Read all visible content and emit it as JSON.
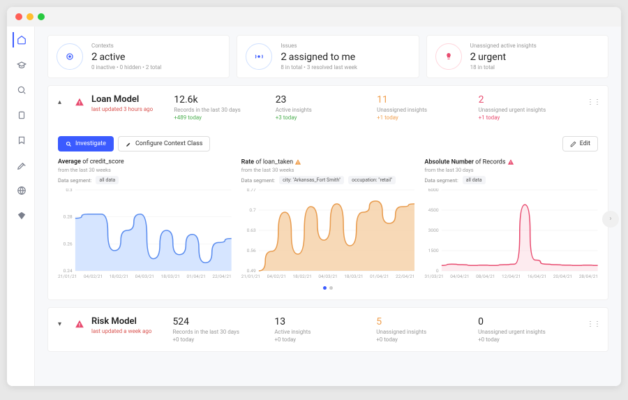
{
  "summary": {
    "contexts": {
      "label": "Contexts",
      "value": "2",
      "suffix": "active",
      "sub": "0 inactive • 0 hidden • 2 total"
    },
    "issues": {
      "label": "Issues",
      "value": "2",
      "suffix": "assigned to me",
      "sub": "8 in total • 3 resolved last week"
    },
    "insights": {
      "label": "Unassigned active insights",
      "value": "2",
      "suffix": "urgent",
      "sub": "18 in total"
    }
  },
  "models": [
    {
      "name": "Loan Model",
      "updated": "last updated 3 hours ago",
      "stats": [
        {
          "value": "12.6k",
          "label": "Records in the last 30 days",
          "delta": "+489 today",
          "vclass": "",
          "dclass": "green"
        },
        {
          "value": "23",
          "label": "Active insights",
          "delta": "+3 today",
          "vclass": "",
          "dclass": "green"
        },
        {
          "value": "11",
          "label": "Unassigned insights",
          "delta": "+1 today",
          "vclass": "orange",
          "dclass": "orange"
        },
        {
          "value": "2",
          "label": "Unassigned urgent insights",
          "delta": "+1 today",
          "vclass": "red",
          "dclass": "red"
        }
      ]
    },
    {
      "name": "Risk Model",
      "updated": "last updated a week ago",
      "stats": [
        {
          "value": "524",
          "label": "Records in the last 30 days",
          "delta": "+0 today",
          "vclass": "",
          "dclass": ""
        },
        {
          "value": "13",
          "label": "Active insights",
          "delta": "+0 today",
          "vclass": "",
          "dclass": ""
        },
        {
          "value": "5",
          "label": "Unassigned insights",
          "delta": "+0 today",
          "vclass": "orange",
          "dclass": ""
        },
        {
          "value": "0",
          "label": "Unassigned urgent insights",
          "delta": "+0 today",
          "vclass": "",
          "dclass": ""
        }
      ]
    }
  ],
  "actions": {
    "investigate": "Investigate",
    "configure": "Configure Context Class",
    "edit": "Edit"
  },
  "chart_data": [
    {
      "type": "area",
      "title_prefix": "Average",
      "title_rest": "of credit_score",
      "subtitle": "from the last 30 weeks",
      "segment_label": "Data segment:",
      "segments": [
        "all data"
      ],
      "warn": false,
      "color": "#5b8def",
      "fill": "#cfe0ff",
      "ylim": [
        0.22,
        0.32
      ],
      "yticks": [
        "0.3",
        "0.28",
        "0.26",
        "0.24"
      ],
      "x": [
        "21/01/21",
        "04/02/21",
        "18/02/21",
        "04/03/21",
        "18/03/21",
        "01/04/21",
        "22/04/21"
      ],
      "values": [
        0.285,
        0.29,
        0.29,
        0.245,
        0.27,
        0.29,
        0.235,
        0.27,
        0.24,
        0.265,
        0.23,
        0.255,
        0.26
      ]
    },
    {
      "type": "area",
      "title_prefix": "Rate",
      "title_rest": "of loan_taken",
      "subtitle": "from the last 30 weeks",
      "segment_label": "Data segment:",
      "segments": [
        "city: \"Arkansas_Fort Smith\"",
        "occupation: \"retail\""
      ],
      "warn": true,
      "color": "#e89b4d",
      "fill": "#f6d2aa",
      "ylim": [
        0.49,
        0.78
      ],
      "yticks": [
        "0.77",
        "0.7",
        "0.63",
        "0.56",
        "0.49"
      ],
      "x": [
        "21/01/21",
        "04/02/21",
        "18/02/21",
        "04/03/21",
        "18/03/21",
        "01/04/21",
        "22/04/21"
      ],
      "values": [
        0.49,
        0.56,
        0.7,
        0.55,
        0.72,
        0.6,
        0.73,
        0.58,
        0.7,
        0.74,
        0.66,
        0.72,
        0.73
      ]
    },
    {
      "type": "line",
      "title_prefix": "Absolute Number",
      "title_rest": "of Records",
      "subtitle": "from the last 30 days",
      "segment_label": "Data segment:",
      "segments": [
        "all data"
      ],
      "warn_red": true,
      "color": "#e84b6f",
      "fill": "#f8c7d2",
      "ylim": [
        0,
        6000
      ],
      "yticks": [
        "6000",
        "4500",
        "3000",
        "1500",
        "0"
      ],
      "x": [
        "31/03/21",
        "04/04/21",
        "08/04/21",
        "12/04/21",
        "16/04/21",
        "20/04/21",
        "28/04/21"
      ],
      "values": [
        400,
        500,
        450,
        400,
        420,
        400,
        450,
        500,
        4900,
        800,
        500,
        450,
        420,
        400,
        420,
        400
      ]
    }
  ]
}
